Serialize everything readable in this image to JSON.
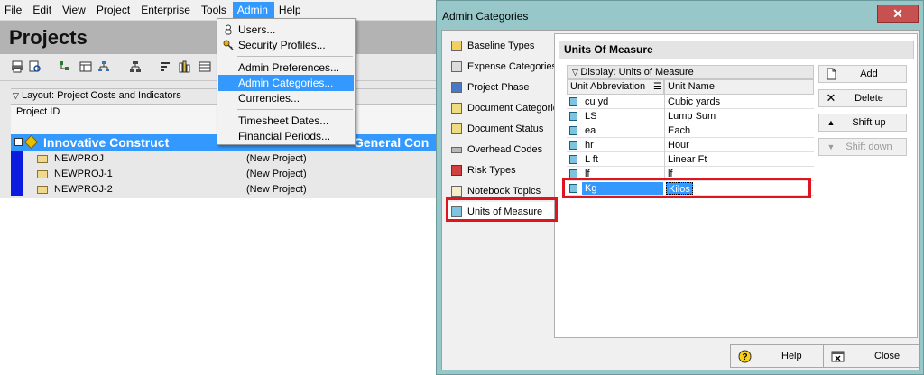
{
  "menubar": {
    "items": [
      "File",
      "Edit",
      "View",
      "Project",
      "Enterprise",
      "Tools",
      "Admin",
      "Help"
    ],
    "active": "Admin"
  },
  "projects": {
    "title": "Projects",
    "layout_label": "Layout: Project Costs and Indicators",
    "column_header": "Project ID",
    "eps_name": "Innovative Construct",
    "eps_right_text": "General Con",
    "rows": [
      {
        "id": "NEWPROJ",
        "name": "(New Project)"
      },
      {
        "id": "NEWPROJ-1",
        "name": "(New Project)"
      },
      {
        "id": "NEWPROJ-2",
        "name": "(New Project)"
      }
    ]
  },
  "admin_menu": {
    "items": [
      "Users...",
      "Security Profiles...",
      "Admin Preferences...",
      "Admin Categories...",
      "Currencies...",
      "Timesheet Dates...",
      "Financial Periods..."
    ],
    "selected": "Admin Categories..."
  },
  "dialog": {
    "title": "Admin Categories",
    "close_glyph": "✕",
    "categories": [
      "Baseline Types",
      "Expense Categories",
      "Project Phase",
      "Document Categories",
      "Document Status",
      "Overhead Codes",
      "Risk Types",
      "Notebook Topics",
      "Units of Measure"
    ],
    "active_category": "Units of Measure",
    "panel_title": "Units Of Measure",
    "display_label": "Display: Units of Measure",
    "columns": [
      "Unit Abbreviation",
      "Unit Name"
    ],
    "units": [
      {
        "abbr": "cu yd",
        "name": "Cubic yards"
      },
      {
        "abbr": "LS",
        "name": "Lump Sum"
      },
      {
        "abbr": "ea",
        "name": "Each"
      },
      {
        "abbr": "hr",
        "name": "Hour"
      },
      {
        "abbr": "L ft",
        "name": "Linear Ft"
      },
      {
        "abbr": "lf",
        "name": "lf"
      },
      {
        "abbr": "Kg",
        "name": "Kilos"
      }
    ],
    "buttons": {
      "add": "Add",
      "delete": "Delete",
      "shift_up": "Shift up",
      "shift_down": "Shift down",
      "help": "Help",
      "close": "Close"
    }
  },
  "colors": {
    "selection": "#3399ff",
    "dialog_frame": "#97c7c9",
    "highlight_box": "#e0141e"
  }
}
